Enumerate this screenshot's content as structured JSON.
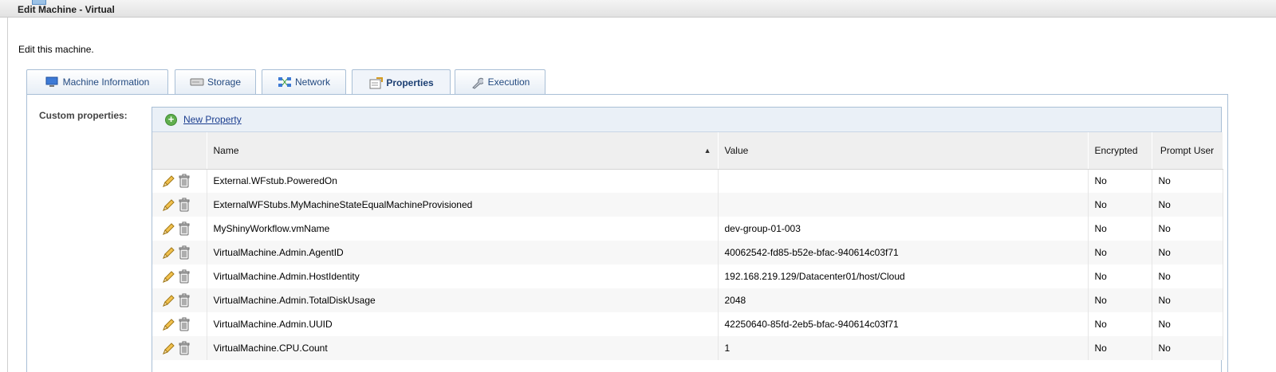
{
  "window": {
    "title": "Edit Machine - Virtual"
  },
  "description": "Edit this machine.",
  "tabs": [
    {
      "label": "Machine Information",
      "icon": "monitor-icon"
    },
    {
      "label": "Storage",
      "icon": "disk-icon"
    },
    {
      "label": "Network",
      "icon": "network-icon"
    },
    {
      "label": "Properties",
      "icon": "properties-icon",
      "active": true
    },
    {
      "label": "Execution",
      "icon": "wrench-icon"
    }
  ],
  "custom_properties_label": "Custom properties:",
  "toolbar": {
    "new_property_label": "New Property"
  },
  "columns": {
    "name": "Name",
    "value": "Value",
    "encrypted": "Encrypted",
    "prompt_user": "Prompt User"
  },
  "rows": [
    {
      "name": "External.WFstub.PoweredOn",
      "value": "",
      "encrypted": "No",
      "prompt_user": "No"
    },
    {
      "name": "ExternalWFStubs.MyMachineStateEqualMachineProvisioned",
      "value": "",
      "encrypted": "No",
      "prompt_user": "No"
    },
    {
      "name": "MyShinyWorkflow.vmName",
      "value": "dev-group-01-003",
      "encrypted": "No",
      "prompt_user": "No"
    },
    {
      "name": "VirtualMachine.Admin.AgentID",
      "value": "40062542-fd85-b52e-bfac-940614c03f71",
      "encrypted": "No",
      "prompt_user": "No"
    },
    {
      "name": "VirtualMachine.Admin.HostIdentity",
      "value": "192.168.219.129/Datacenter01/host/Cloud",
      "encrypted": "No",
      "prompt_user": "No"
    },
    {
      "name": "VirtualMachine.Admin.TotalDiskUsage",
      "value": "2048",
      "encrypted": "No",
      "prompt_user": "No"
    },
    {
      "name": "VirtualMachine.Admin.UUID",
      "value": "42250640-85fd-2eb5-bfac-940614c03f71",
      "encrypted": "No",
      "prompt_user": "No"
    },
    {
      "name": "VirtualMachine.CPU.Count",
      "value": "1",
      "encrypted": "No",
      "prompt_user": "No"
    }
  ],
  "colors": {
    "tab_text": "#234a80",
    "link": "#1a3d8f",
    "border": "#a9bfd6"
  }
}
